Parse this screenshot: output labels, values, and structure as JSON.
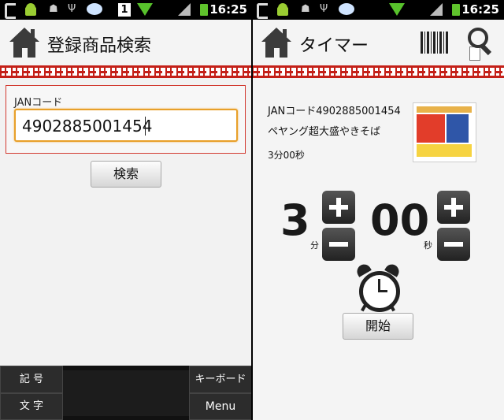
{
  "status_bar": {
    "time": "16:25",
    "badge": "1"
  },
  "left_screen": {
    "title": "登録商品検索",
    "jan_label": "JANコード",
    "jan_value": "4902885001454",
    "search_button": "検索",
    "keyboard_bar": {
      "kigo": "記 号",
      "moji": "文 字",
      "keyboard": "キーボード",
      "menu": "Menu"
    }
  },
  "right_screen": {
    "title": "タイマー",
    "jan_info": "JANコード4902885001454",
    "product_name": "ペヤング超大盛やきそば",
    "time_text": "3分00秒",
    "minutes": "3",
    "seconds": "00",
    "minute_unit": "分",
    "second_unit": "秒",
    "start_button": "開始"
  },
  "colors": {
    "accent_border": "#d23a30",
    "focus": "#e8a02a",
    "greca": "#c42018",
    "wifi": "#58c22c"
  }
}
